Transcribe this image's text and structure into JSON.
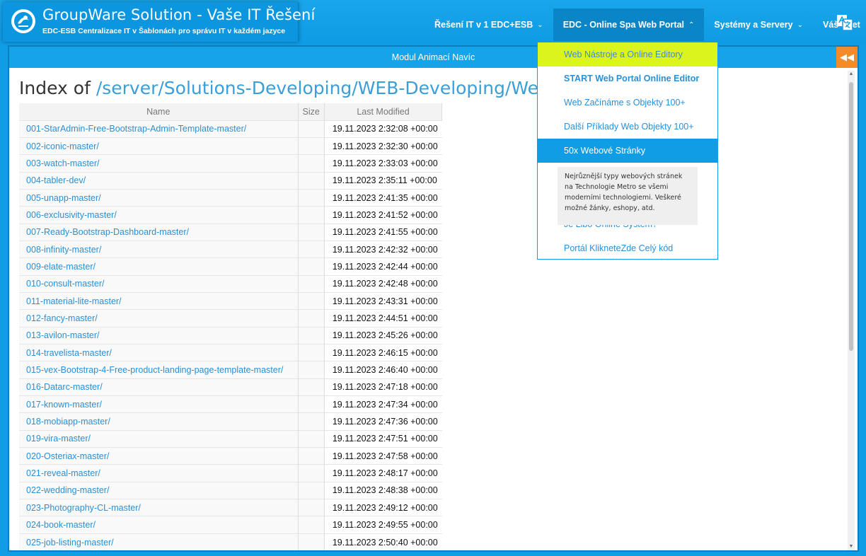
{
  "brand": {
    "title": "GroupWare Solution - Vaše IT Řešení",
    "subtitle": "EDC-ESB Centralizace IT v Šablonách pro správu IT v každém jazyce"
  },
  "nav": {
    "items": [
      {
        "label": "Řešení IT v 1 EDC+ESB",
        "chevron": "⌄"
      },
      {
        "label": "EDC - Online Spa Web Portal",
        "chevron": "⌃"
      },
      {
        "label": "Systémy a Servery",
        "chevron": "⌄"
      },
      {
        "label": "Váš Účet",
        "chevron": "⌄"
      }
    ],
    "language_icon": "translate-icon"
  },
  "panel": {
    "header": "Modul Animací Navíc",
    "collapse_icon": "double-chevron-left-icon"
  },
  "listing": {
    "title_prefix": "Index of ",
    "path": "/server/Solutions-Developing/WEB-Developing/WebPages-Te",
    "columns": {
      "name": "Name",
      "size": "Size",
      "modified": "Last Modified"
    },
    "rows": [
      {
        "name": "001-StarAdmin-Free-Bootstrap-Admin-Template-master/",
        "size": "",
        "modified": "19.11.2023 2:32:08 +00:00"
      },
      {
        "name": "002-iconic-master/",
        "size": "",
        "modified": "19.11.2023 2:32:30 +00:00"
      },
      {
        "name": "003-watch-master/",
        "size": "",
        "modified": "19.11.2023 2:33:03 +00:00"
      },
      {
        "name": "004-tabler-dev/",
        "size": "",
        "modified": "19.11.2023 2:35:11 +00:00"
      },
      {
        "name": "005-unapp-master/",
        "size": "",
        "modified": "19.11.2023 2:41:35 +00:00"
      },
      {
        "name": "006-exclusivity-master/",
        "size": "",
        "modified": "19.11.2023 2:41:52 +00:00"
      },
      {
        "name": "007-Ready-Bootstrap-Dashboard-master/",
        "size": "",
        "modified": "19.11.2023 2:41:55 +00:00"
      },
      {
        "name": "008-infinity-master/",
        "size": "",
        "modified": "19.11.2023 2:42:32 +00:00"
      },
      {
        "name": "009-elate-master/",
        "size": "",
        "modified": "19.11.2023 2:42:44 +00:00"
      },
      {
        "name": "010-consult-master/",
        "size": "",
        "modified": "19.11.2023 2:42:48 +00:00"
      },
      {
        "name": "011-material-lite-master/",
        "size": "",
        "modified": "19.11.2023 2:43:31 +00:00"
      },
      {
        "name": "012-fancy-master/",
        "size": "",
        "modified": "19.11.2023 2:44:51 +00:00"
      },
      {
        "name": "013-avilon-master/",
        "size": "",
        "modified": "19.11.2023 2:45:26 +00:00"
      },
      {
        "name": "014-travelista-master/",
        "size": "",
        "modified": "19.11.2023 2:46:15 +00:00"
      },
      {
        "name": "015-vex-Bootstrap-4-Free-product-landing-page-template-master/",
        "size": "",
        "modified": "19.11.2023 2:46:40 +00:00"
      },
      {
        "name": "016-Datarc-master/",
        "size": "",
        "modified": "19.11.2023 2:47:18 +00:00"
      },
      {
        "name": "017-known-master/",
        "size": "",
        "modified": "19.11.2023 2:47:34 +00:00"
      },
      {
        "name": "018-mobiapp-master/",
        "size": "",
        "modified": "19.11.2023 2:47:36 +00:00"
      },
      {
        "name": "019-vira-master/",
        "size": "",
        "modified": "19.11.2023 2:47:51 +00:00"
      },
      {
        "name": "020-Osteriax-master/",
        "size": "",
        "modified": "19.11.2023 2:47:58 +00:00"
      },
      {
        "name": "021-reveal-master/",
        "size": "",
        "modified": "19.11.2023 2:48:17 +00:00"
      },
      {
        "name": "022-wedding-master/",
        "size": "",
        "modified": "19.11.2023 2:48:38 +00:00"
      },
      {
        "name": "023-Photography-CL-master/",
        "size": "",
        "modified": "19.11.2023 2:49:12 +00:00"
      },
      {
        "name": "024-book-master/",
        "size": "",
        "modified": "19.11.2023 2:49:55 +00:00"
      },
      {
        "name": "025-job-listing-master/",
        "size": "",
        "modified": "19.11.2023 2:50:40 +00:00"
      }
    ]
  },
  "dropdown": {
    "items": [
      {
        "label": "Web Nástroje a Online Editory",
        "state": "hovered"
      },
      {
        "label": "START Web Portal Online Editor",
        "state": "bold"
      },
      {
        "label": "Web Začínáme s Objekty 100+",
        "state": ""
      },
      {
        "label": "Další Příklady Web Objekty 100+",
        "state": ""
      },
      {
        "label": "50x Webové Stránky",
        "state": "selected"
      },
      {
        "label": "Je Libo Online Systém?",
        "state": ""
      },
      {
        "label": "Portál KlikneteZde Celý kód",
        "state": ""
      }
    ],
    "tooltip": "Nejrůznější typy webových stránek na Technologie Metro se všemi moderními technologiemi. Veškeré možné žánky, eshopy, atd."
  },
  "colors": {
    "header_blue": "#0f9ee6",
    "link_blue": "#2b8fd6",
    "hover_yellow": "#dbf51c",
    "collapse_orange": "#f48a28"
  }
}
